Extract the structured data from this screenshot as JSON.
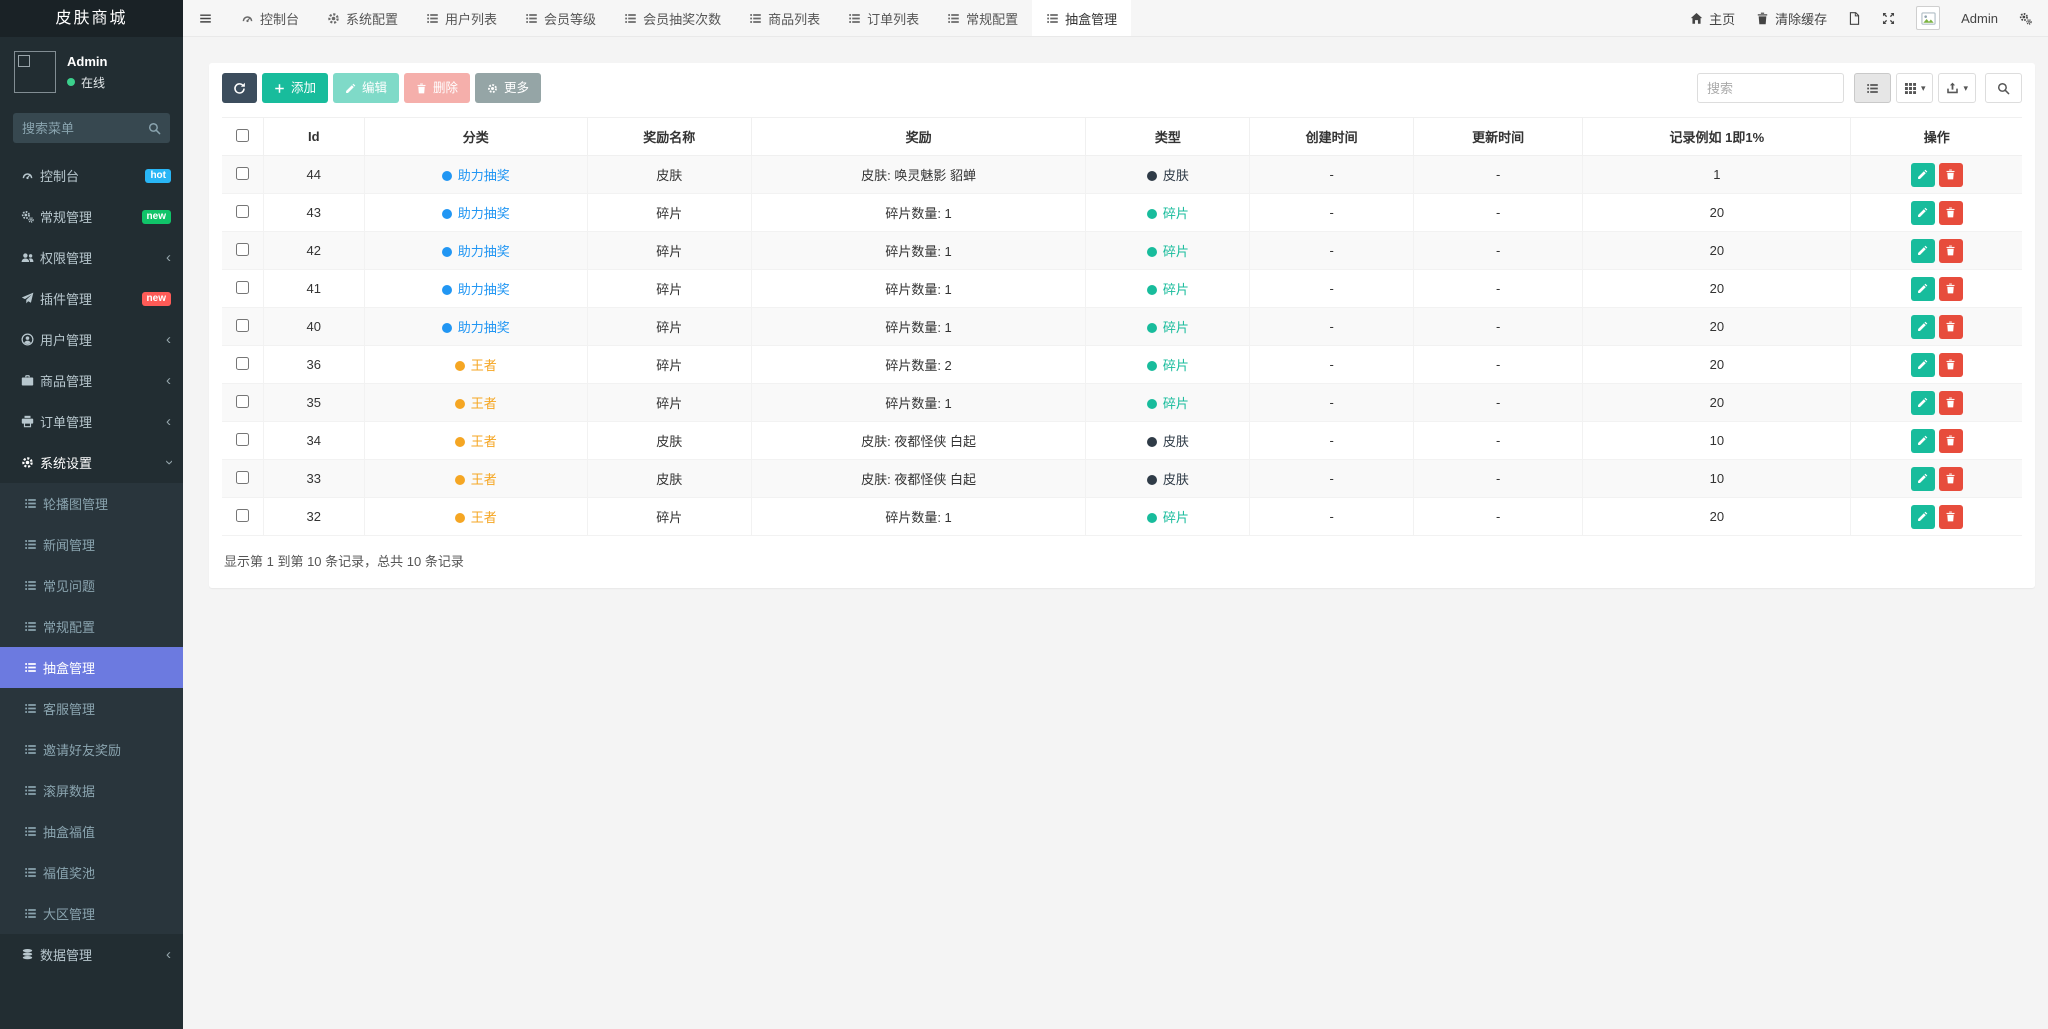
{
  "app": {
    "title": "皮肤商城"
  },
  "topbar": {
    "tabs": [
      {
        "label": "控制台",
        "icon": "dashboard-icon",
        "active": false
      },
      {
        "label": "系统配置",
        "icon": "gear-icon",
        "active": false
      },
      {
        "label": "用户列表",
        "icon": "list-icon",
        "active": false
      },
      {
        "label": "会员等级",
        "icon": "list-icon",
        "active": false
      },
      {
        "label": "会员抽奖次数",
        "icon": "list-icon",
        "active": false
      },
      {
        "label": "商品列表",
        "icon": "list-icon",
        "active": false
      },
      {
        "label": "订单列表",
        "icon": "list-icon",
        "active": false
      },
      {
        "label": "常规配置",
        "icon": "list-icon",
        "active": false
      },
      {
        "label": "抽盒管理",
        "icon": "list-icon",
        "active": true
      }
    ],
    "home_label": "主页",
    "clear_cache_label": "清除缓存",
    "username": "Admin"
  },
  "sidebar": {
    "user": {
      "name": "Admin",
      "status": "在线"
    },
    "search_placeholder": "搜索菜单",
    "menu": [
      {
        "label": "控制台",
        "icon": "tachometer-icon",
        "badge": {
          "text": "hot",
          "color": "#29b6f6"
        }
      },
      {
        "label": "常规管理",
        "icon": "cogs-icon",
        "badge": {
          "text": "new",
          "color": "#10c469"
        }
      },
      {
        "label": "权限管理",
        "icon": "users-icon",
        "chevron": true
      },
      {
        "label": "插件管理",
        "icon": "plane-icon",
        "badge": {
          "text": "new",
          "color": "#ff5b57"
        }
      },
      {
        "label": "用户管理",
        "icon": "user-icon",
        "chevron": true
      },
      {
        "label": "商品管理",
        "icon": "briefcase-icon",
        "chevron": true
      },
      {
        "label": "订单管理",
        "icon": "printer-icon",
        "chevron": true
      },
      {
        "label": "系统设置",
        "icon": "gear-icon",
        "expanded": true,
        "children": [
          {
            "label": "轮播图管理"
          },
          {
            "label": "新闻管理"
          },
          {
            "label": "常见问题"
          },
          {
            "label": "常规配置"
          },
          {
            "label": "抽盒管理",
            "active": true
          },
          {
            "label": "客服管理"
          },
          {
            "label": "邀请好友奖励"
          },
          {
            "label": "滚屏数据"
          },
          {
            "label": "抽盒福值"
          },
          {
            "label": "福值奖池"
          },
          {
            "label": "大区管理"
          }
        ]
      },
      {
        "label": "数据管理",
        "icon": "database-icon",
        "chevron": true
      }
    ]
  },
  "toolbar": {
    "add_label": "添加",
    "edit_label": "编辑",
    "delete_label": "删除",
    "more_label": "更多",
    "search_placeholder": "搜索"
  },
  "table": {
    "columns": [
      "Id",
      "分类",
      "奖励名称",
      "奖励",
      "类型",
      "创建时间",
      "更新时间",
      "记录例如 1即1%",
      "操作"
    ],
    "rows": [
      {
        "id": "44",
        "category": "助力抽奖",
        "category_color": "#2196f3",
        "reward_name": "皮肤",
        "reward": "皮肤: 唤灵魅影 貂蝉",
        "type": "皮肤",
        "type_color": "#2f3b47",
        "created": "-",
        "updated": "-",
        "record": "1"
      },
      {
        "id": "43",
        "category": "助力抽奖",
        "category_color": "#2196f3",
        "reward_name": "碎片",
        "reward": "碎片数量: 1",
        "type": "碎片",
        "type_color": "#18bc9c",
        "created": "-",
        "updated": "-",
        "record": "20"
      },
      {
        "id": "42",
        "category": "助力抽奖",
        "category_color": "#2196f3",
        "reward_name": "碎片",
        "reward": "碎片数量: 1",
        "type": "碎片",
        "type_color": "#18bc9c",
        "created": "-",
        "updated": "-",
        "record": "20"
      },
      {
        "id": "41",
        "category": "助力抽奖",
        "category_color": "#2196f3",
        "reward_name": "碎片",
        "reward": "碎片数量: 1",
        "type": "碎片",
        "type_color": "#18bc9c",
        "created": "-",
        "updated": "-",
        "record": "20"
      },
      {
        "id": "40",
        "category": "助力抽奖",
        "category_color": "#2196f3",
        "reward_name": "碎片",
        "reward": "碎片数量: 1",
        "type": "碎片",
        "type_color": "#18bc9c",
        "created": "-",
        "updated": "-",
        "record": "20"
      },
      {
        "id": "36",
        "category": "王者",
        "category_color": "#f5a623",
        "reward_name": "碎片",
        "reward": "碎片数量: 2",
        "type": "碎片",
        "type_color": "#18bc9c",
        "created": "-",
        "updated": "-",
        "record": "20"
      },
      {
        "id": "35",
        "category": "王者",
        "category_color": "#f5a623",
        "reward_name": "碎片",
        "reward": "碎片数量: 1",
        "type": "碎片",
        "type_color": "#18bc9c",
        "created": "-",
        "updated": "-",
        "record": "20"
      },
      {
        "id": "34",
        "category": "王者",
        "category_color": "#f5a623",
        "reward_name": "皮肤",
        "reward": "皮肤: 夜都怪侠 白起",
        "type": "皮肤",
        "type_color": "#2f3b47",
        "created": "-",
        "updated": "-",
        "record": "10"
      },
      {
        "id": "33",
        "category": "王者",
        "category_color": "#f5a623",
        "reward_name": "皮肤",
        "reward": "皮肤: 夜都怪侠 白起",
        "type": "皮肤",
        "type_color": "#2f3b47",
        "created": "-",
        "updated": "-",
        "record": "10"
      },
      {
        "id": "32",
        "category": "王者",
        "category_color": "#f5a623",
        "reward_name": "碎片",
        "reward": "碎片数量: 1",
        "type": "碎片",
        "type_color": "#18bc9c",
        "created": "-",
        "updated": "-",
        "record": "20"
      }
    ],
    "summary": "显示第 1 到第 10 条记录，总共 10 条记录"
  },
  "colors": {
    "online_green": "#3bd08c",
    "btn_refresh": "#3c4d5d",
    "btn_add": "#18bc9c",
    "btn_edit": "#18bc9c",
    "btn_delete": "#ee6e68",
    "btn_more": "#95a5a6",
    "sidebar_active": "#6c7ae0",
    "action_edit": "#18bc9c",
    "action_delete": "#e74c3c"
  }
}
